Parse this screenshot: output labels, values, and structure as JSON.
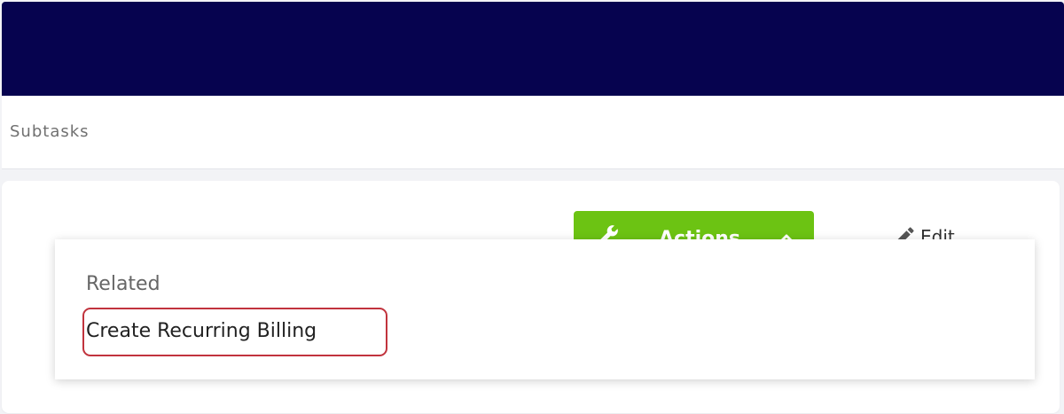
{
  "tabs": {
    "active_label": "Subtasks"
  },
  "toolbar": {
    "actions_label": "Actions",
    "edit_label": "Edit"
  },
  "related_menu": {
    "heading": "Related",
    "items": [
      {
        "label": "Create Recurring Billing"
      }
    ]
  },
  "colors": {
    "header": "#06034f",
    "actions_button": "#6cc313",
    "highlight_border": "#c1333d"
  },
  "icons": {
    "actions_button": "wrench-icon",
    "actions_toggle": "chevron-up-icon",
    "edit": "pencil-icon"
  }
}
